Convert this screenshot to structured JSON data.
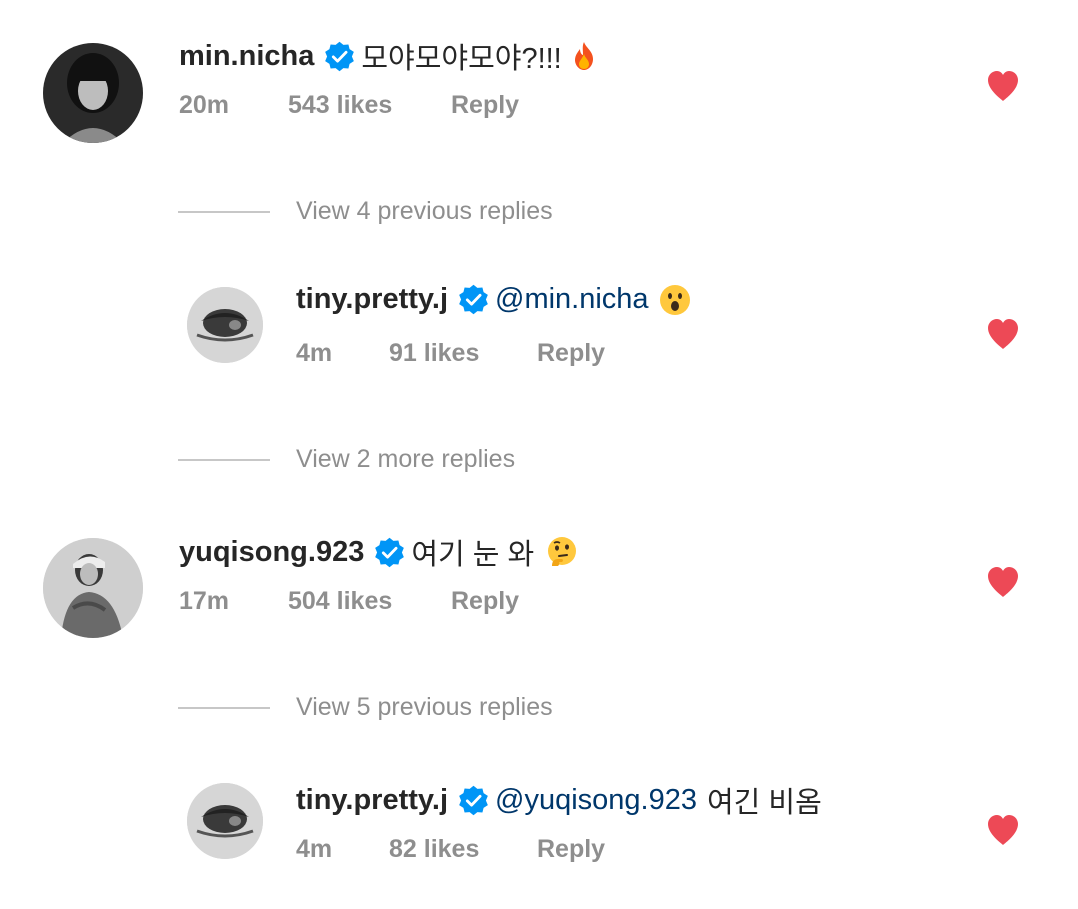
{
  "comments": [
    {
      "username": "min.nicha",
      "verified": true,
      "mention": "",
      "text": "모야모야모야?!!!",
      "emoji": "fire-emoji",
      "time": "20m",
      "likes": "543 likes",
      "reply_label": "Reply",
      "liked": true
    },
    {
      "view_replies": "View 4 previous replies"
    },
    {
      "username": "tiny.pretty.j",
      "verified": true,
      "mention": "@min.nicha",
      "text": "",
      "emoji": "surprised-face-emoji",
      "time": "4m",
      "likes": "91 likes",
      "reply_label": "Reply",
      "liked": true
    },
    {
      "view_replies": "View 2 more replies"
    },
    {
      "username": "yuqisong.923",
      "verified": true,
      "mention": "",
      "text": "여기 눈 와",
      "emoji": "thinking-face-emoji",
      "time": "17m",
      "likes": "504 likes",
      "reply_label": "Reply",
      "liked": true
    },
    {
      "view_replies": "View 5 previous replies"
    },
    {
      "username": "tiny.pretty.j",
      "verified": true,
      "mention": "@yuqisong.923",
      "text": "여긴 비옴",
      "emoji": "",
      "time": "4m",
      "likes": "82 likes",
      "reply_label": "Reply",
      "liked": true
    }
  ],
  "colors": {
    "text": "#262626",
    "muted": "#8e8e8e",
    "mention": "#00376b",
    "verified": "#0095f6",
    "heart": "#ed4956"
  }
}
